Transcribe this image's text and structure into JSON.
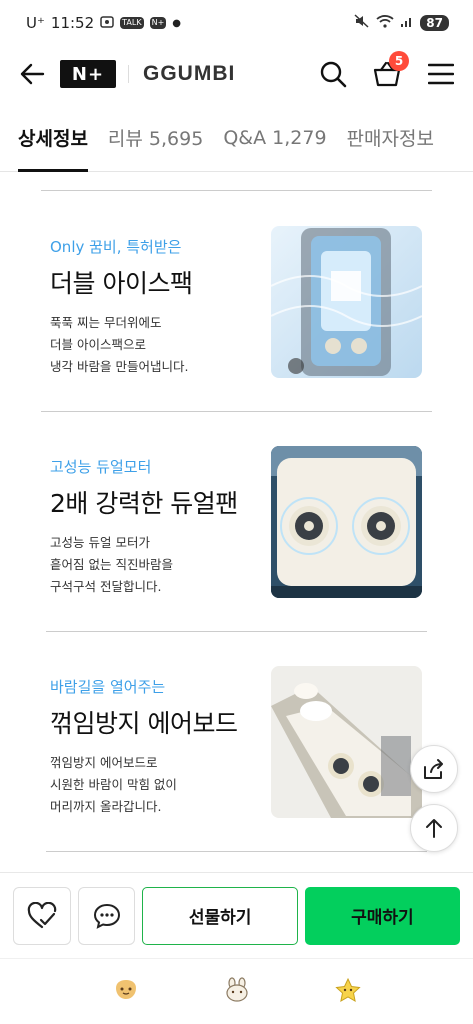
{
  "status_bar": {
    "carrier": "U⁺",
    "time": "11:52",
    "battery": "87",
    "notif_labels": [
      "TALK",
      "N+"
    ]
  },
  "header": {
    "logo": "N+",
    "brand": "GGUMBI",
    "cart_count": "5"
  },
  "tabs": [
    {
      "label": "상세정보",
      "active": true
    },
    {
      "label": "리뷰 5,695",
      "active": false
    },
    {
      "label": "Q&A 1,279",
      "active": false
    },
    {
      "label": "판매자정보",
      "active": false
    }
  ],
  "features": [
    {
      "tagline": "Only 꿈비, 특허받은",
      "title": "더블 아이스팩",
      "desc": [
        "푹푹 찌는 무더위에도",
        "더블 아이스팩으로",
        "냉각 바람을 만들어냅니다."
      ]
    },
    {
      "tagline": "고성능 듀얼모터",
      "title": "2배 강력한 듀얼팬",
      "desc": [
        "고성능 듀얼 모터가",
        "흩어짐 없는 직진바람을",
        "구석구석 전달합니다."
      ]
    },
    {
      "tagline": "바람길을 열어주는",
      "title": "꺾임방지 에어보드",
      "desc": [
        "꺾임방지 에어보드로",
        "시원한 바람이 막힘 없이",
        "머리까지 올라갑니다."
      ]
    }
  ],
  "actions": {
    "gift_label": "선물하기",
    "buy_label": "구매하기"
  },
  "colors": {
    "accent_green": "#03cf5d",
    "tagline_blue": "#3ea0e8",
    "badge_red": "#ff4b3a"
  }
}
